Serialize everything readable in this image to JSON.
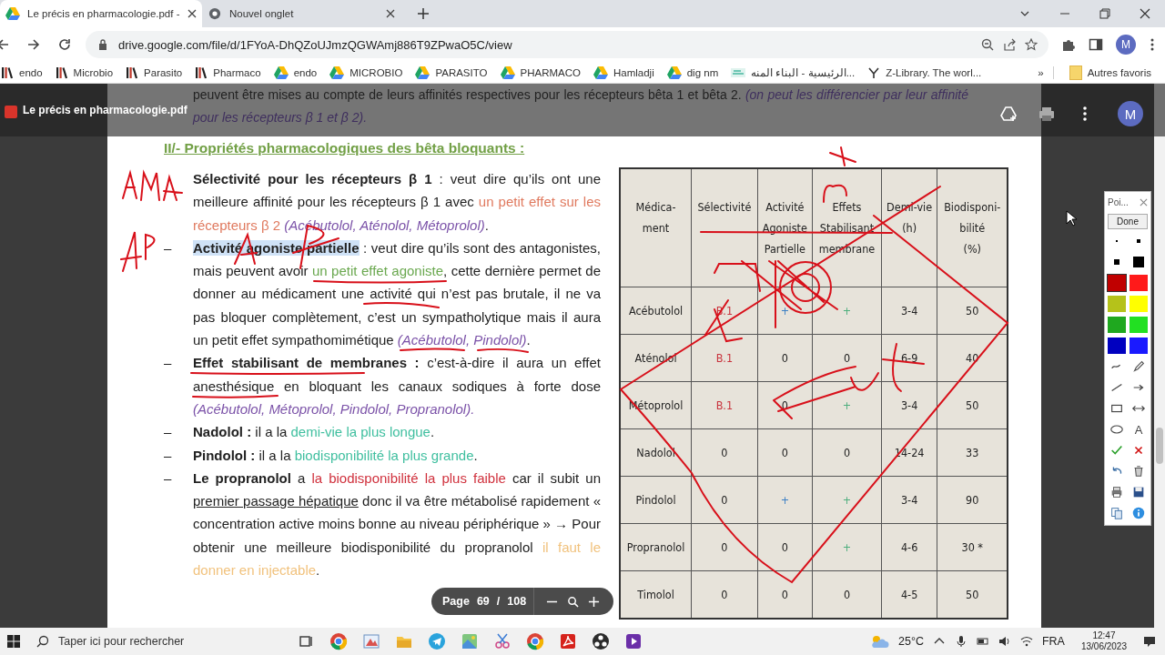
{
  "browser": {
    "tabs": [
      {
        "title": "Le précis en pharmacologie.pdf -",
        "selected": true
      },
      {
        "title": "Nouvel onglet",
        "selected": false
      }
    ],
    "url": "drive.google.com/file/d/1FYoA-DhQZoUJmzQGWAmj886T9ZPwaO5C/view",
    "profile_initial": "M",
    "bookmarks": [
      {
        "label": "endo",
        "kind": "library"
      },
      {
        "label": "Microbio",
        "kind": "library"
      },
      {
        "label": "Parasito",
        "kind": "library"
      },
      {
        "label": "Pharmaco",
        "kind": "library"
      },
      {
        "label": "endo",
        "kind": "drive"
      },
      {
        "label": "MICROBIO",
        "kind": "drive"
      },
      {
        "label": "PARASITO",
        "kind": "drive"
      },
      {
        "label": "PHARMACO",
        "kind": "drive"
      },
      {
        "label": "Hamladji",
        "kind": "drive"
      },
      {
        "label": "dig nm",
        "kind": "drive"
      },
      {
        "label": "الرئيسية - البناء المنه...",
        "kind": "site"
      },
      {
        "label": "Z-Library. The worl...",
        "kind": "zlib"
      }
    ],
    "more_bookmarks": "»",
    "other_bookmarks": "Autres favoris"
  },
  "viewer": {
    "file_name": "Le précis en pharmacologie.pdf",
    "profile_initial": "M",
    "page_label": "Page",
    "page": "69",
    "page_separator": "/",
    "page_count": "108"
  },
  "document": {
    "intro": [
      {
        "text": "peuvent être mises au compte de leurs affinités respectives pour les récepteurs bêta 1 et bêta 2. "
      },
      {
        "text": "(on peut les différencier par leur affinité pour les récepteurs β 1 et β 2).",
        "italic": true,
        "color": "#3f2f5e"
      }
    ],
    "heading": "II/- Propriétés pharmacologiques des bêta bloquants :",
    "items": [
      {
        "paragraph": [
          {
            "text": "Sélectivité pour les récepteurs β 1",
            "bold": true
          },
          {
            "text": " : veut dire qu’ils ont une meilleure affinité pour les récepteurs β 1 avec "
          },
          {
            "text": "un petit effet sur les récepteurs β 2 ",
            "color": "#e07a5f"
          },
          {
            "text": "(Acébutolol, Aténolol, Métoprolol)",
            "italic": true,
            "color": "#7b52a8"
          },
          {
            "text": "."
          }
        ]
      },
      {
        "marker": "–",
        "paragraph": [
          {
            "text": "Activité agoniste partielle",
            "bold": true,
            "highlight": true
          },
          {
            "text": " : veut dire qu’ils sont des antagonistes, mais peuvent avoir "
          },
          {
            "text": "un petit effet agoniste",
            "color": "#6aa84f"
          },
          {
            "text": ", cette dernière permet de donner au médicament une activité qui n’est pas brutale, il ne va pas bloquer complètement, c’est un sympatholytique mais il aura un petit effet sympathomimétique "
          },
          {
            "text": "(Acébutolol, Pindolol)",
            "italic": true,
            "color": "#7b52a8"
          },
          {
            "text": "."
          }
        ]
      },
      {
        "marker": "–",
        "paragraph": [
          {
            "text": "Effet stabilisant de membranes :",
            "bold": true
          },
          {
            "text": " c’est-à-dire il aura un effet anesthésique en bloquant les canaux sodiques à forte dose "
          },
          {
            "text": "(Acébutolol, Métoprolol, Pindolol, Propranolol).",
            "italic": true,
            "color": "#7b52a8"
          }
        ]
      },
      {
        "marker": "–",
        "paragraph": [
          {
            "text": "Nadolol :",
            "bold": true
          },
          {
            "text": " il a la "
          },
          {
            "text": "demi-vie la plus longue",
            "color": "#3fbf9f"
          },
          {
            "text": "."
          }
        ]
      },
      {
        "marker": "–",
        "paragraph": [
          {
            "text": "Pindolol :",
            "bold": true
          },
          {
            "text": " il a la "
          },
          {
            "text": "biodisponibilité la plus grande",
            "color": "#3fbf9f"
          },
          {
            "text": "."
          }
        ]
      },
      {
        "marker": "–",
        "paragraph": [
          {
            "text": "Le propranolol",
            "bold": true
          },
          {
            "text": " a "
          },
          {
            "text": "la biodisponibilité la plus faible",
            "color": "#d0313d"
          },
          {
            "text": " car il subit un "
          },
          {
            "text": "premier passage hépatique",
            "underline": true
          },
          {
            "text": " donc il va être métabolisé rapidement « concentration active moins bonne au niveau périphérique » → Pour obtenir une meilleure biodisponibilité du propranolol "
          },
          {
            "text": "il faut le donner en injectable",
            "color": "#f1c27d"
          },
          {
            "text": "."
          }
        ]
      }
    ],
    "table": {
      "columns": [
        {
          "lines": [
            "Médica-",
            "ment"
          ]
        },
        {
          "lines": [
            "Sélectivité"
          ]
        },
        {
          "lines": [
            "Activité",
            "Agoniste",
            "Partielle"
          ]
        },
        {
          "lines": [
            "Effets",
            "Stabilisant",
            "membrane"
          ]
        },
        {
          "lines": [
            "Demi-vie",
            "(h)"
          ]
        },
        {
          "lines": [
            "Biodisponi-",
            "bilité",
            "(%)"
          ]
        }
      ],
      "rows": [
        [
          {
            "text": "Acébutolol"
          },
          {
            "text": "B.1",
            "color": "#c8323c"
          },
          {
            "text": "+",
            "color": "#3b7fc4"
          },
          {
            "text": "+",
            "color": "#4cae7c"
          },
          {
            "text": "3-4"
          },
          {
            "text": "50"
          }
        ],
        [
          {
            "text": "Aténolol"
          },
          {
            "text": "B.1",
            "color": "#c8323c"
          },
          {
            "text": "0"
          },
          {
            "text": "0"
          },
          {
            "text": "6-9"
          },
          {
            "text": "40"
          }
        ],
        [
          {
            "text": "Métoprolol"
          },
          {
            "text": "B.1",
            "color": "#c8323c"
          },
          {
            "text": "0"
          },
          {
            "text": "+",
            "color": "#4cae7c"
          },
          {
            "text": "3-4"
          },
          {
            "text": "50"
          }
        ],
        [
          {
            "text": "Nadolol"
          },
          {
            "text": "0"
          },
          {
            "text": "0"
          },
          {
            "text": "0"
          },
          {
            "text": "14-24"
          },
          {
            "text": "33"
          }
        ],
        [
          {
            "text": "Pindolol"
          },
          {
            "text": "0"
          },
          {
            "text": "+",
            "color": "#3b7fc4"
          },
          {
            "text": "+",
            "color": "#4cae7c"
          },
          {
            "text": "3-4"
          },
          {
            "text": "90"
          }
        ],
        [
          {
            "text": "Propranolol"
          },
          {
            "text": "0"
          },
          {
            "text": "0"
          },
          {
            "text": "+",
            "color": "#4cae7c"
          },
          {
            "text": "4-6"
          },
          {
            "text": "30 *"
          }
        ],
        [
          {
            "text": "Timolol"
          },
          {
            "text": "0"
          },
          {
            "text": "0"
          },
          {
            "text": "0"
          },
          {
            "text": "4-5"
          },
          {
            "text": "50"
          }
        ]
      ]
    }
  },
  "pen_tool": {
    "title": "Poi...",
    "done_button": "Done",
    "items": [
      {
        "kind": "dot-small",
        "selected": false
      },
      {
        "kind": "dot",
        "selected": false
      },
      {
        "kind": "square-small",
        "selected": false
      },
      {
        "kind": "square",
        "selected": false
      },
      {
        "kind": "swatch",
        "color": "#c00000",
        "selected": true
      },
      {
        "kind": "swatch",
        "color": "#ff1a1a",
        "selected": false
      },
      {
        "kind": "swatch",
        "color": "#b5c21a",
        "selected": false
      },
      {
        "kind": "swatch",
        "color": "#ffff00",
        "selected": false
      },
      {
        "kind": "swatch",
        "color": "#1fa81f",
        "selected": false
      },
      {
        "kind": "swatch",
        "color": "#22e022",
        "selected": false
      },
      {
        "kind": "swatch",
        "color": "#0000c0",
        "selected": false
      },
      {
        "kind": "swatch",
        "color": "#1a1aff",
        "selected": false
      },
      {
        "kind": "curve"
      },
      {
        "kind": "pen"
      },
      {
        "kind": "line"
      },
      {
        "kind": "arrow"
      },
      {
        "kind": "rect"
      },
      {
        "kind": "double-arrow"
      },
      {
        "kind": "ellipse"
      },
      {
        "kind": "text",
        "label": "A"
      },
      {
        "kind": "check"
      },
      {
        "kind": "cross"
      },
      {
        "kind": "undo"
      },
      {
        "kind": "trash"
      },
      {
        "kind": "print"
      },
      {
        "kind": "save"
      },
      {
        "kind": "copy"
      },
      {
        "kind": "info"
      }
    ]
  },
  "taskbar": {
    "search_placeholder": "Taper ici pour rechercher",
    "weather": "25°C",
    "language": "FRA",
    "time": "12:47",
    "date": "13/06/2023"
  }
}
